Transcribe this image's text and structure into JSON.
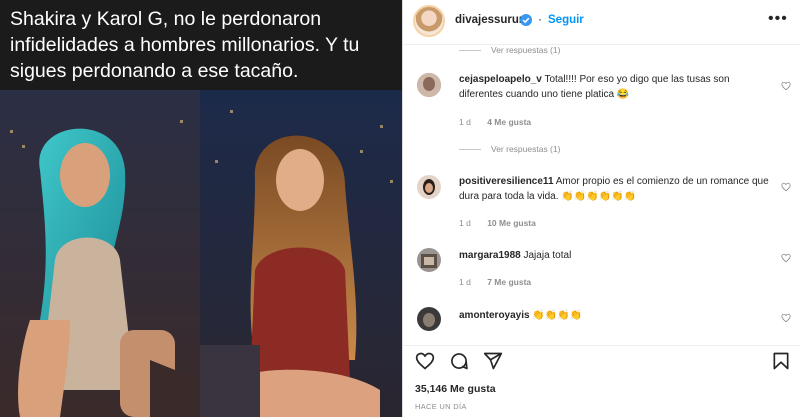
{
  "post": {
    "caption_image_text": "Shakira y Karol G, no le perdonaron infidelidades a hombres millonarios. Y tu sigues perdonando a ese tacaño.",
    "author": "divajessurum",
    "follow_label": "Seguir",
    "more_label": "•••"
  },
  "comments": [
    {
      "type": "replies",
      "label": "Ver respuestas (1)"
    },
    {
      "type": "comment",
      "user": "cejaspeloapelo_v",
      "text": "Total!!!! Por eso yo digo que las tusas son diferentes cuando uno tiene platica 😂",
      "time": "1 d",
      "likes": "4 Me gusta"
    },
    {
      "type": "replies",
      "label": "Ver respuestas (1)"
    },
    {
      "type": "comment",
      "user": "positiveresilience11",
      "text": "Amor propio es el comienzo de un romance que dura para toda la vida. 👏👏👏👏👏👏",
      "time": "1 d",
      "likes": "10 Me gusta"
    },
    {
      "type": "comment",
      "user": "margara1988",
      "text": "Jajaja total",
      "time": "1 d",
      "likes": "7 Me gusta"
    },
    {
      "type": "comment",
      "user": "amonteroyayis",
      "text": "👏👏👏👏",
      "time": "",
      "likes": ""
    }
  ],
  "footer": {
    "likes": "35,146 Me gusta",
    "time_ago": "HACE UN DÍA"
  },
  "colors": {
    "link": "#0095f6",
    "text": "#262626",
    "muted": "#8e8e8e",
    "verified": "#3897f0"
  },
  "icons": [
    "verified-badge-icon",
    "heart-icon",
    "comment-icon",
    "share-icon",
    "bookmark-icon",
    "more-icon"
  ]
}
